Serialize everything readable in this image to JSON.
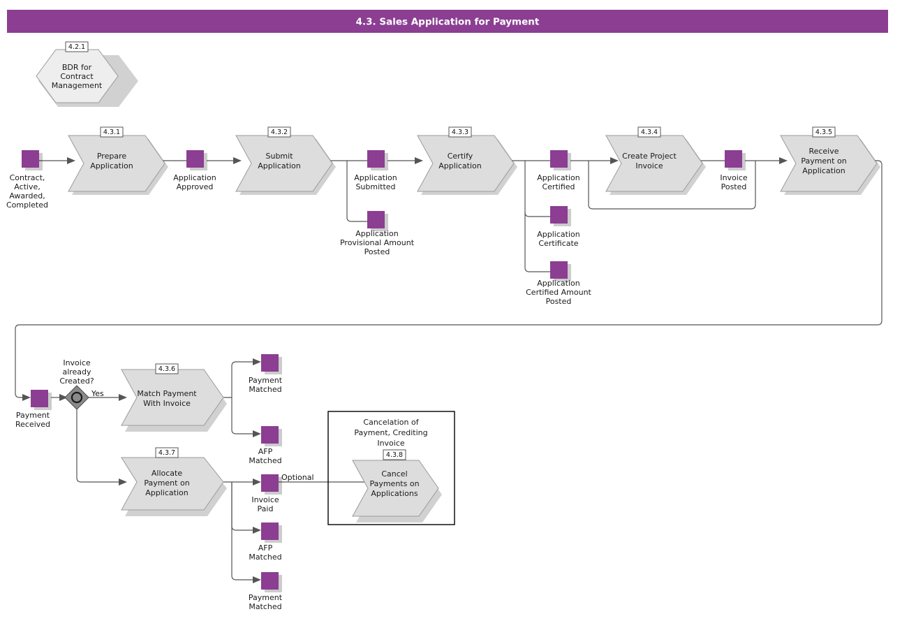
{
  "diagram": {
    "title": "4.3. Sales Application for Payment",
    "accent_color": "#8B3E92",
    "shape_fill": "#DDDDDD",
    "shape_stroke": "#9A9A9A",
    "hex_fill": "#EEEEEE",
    "line_color": "#555555"
  },
  "link_node": {
    "code": "4.2.1",
    "label_lines": [
      "BDR for",
      "Contract",
      "Management"
    ]
  },
  "tasks": [
    {
      "code": "4.3.1",
      "label_lines": [
        "Prepare",
        "Application"
      ]
    },
    {
      "code": "4.3.2",
      "label_lines": [
        "Submit",
        "Application"
      ]
    },
    {
      "code": "4.3.3",
      "label_lines": [
        "Certify",
        "Application"
      ]
    },
    {
      "code": "4.3.4",
      "label_lines": [
        "Create Project",
        "Invoice"
      ]
    },
    {
      "code": "4.3.5",
      "label_lines": [
        "Receive",
        "Payment on",
        "Application"
      ]
    },
    {
      "code": "4.3.6",
      "label_lines": [
        "Match Payment",
        "With Invoice"
      ]
    },
    {
      "code": "4.3.7",
      "label_lines": [
        "Allocate",
        "Payment on",
        "Application"
      ]
    },
    {
      "code": "4.3.8",
      "label_lines": [
        "Cancel",
        "Payments on",
        "Applications"
      ]
    }
  ],
  "events": [
    {
      "id": "contract-active",
      "label_lines": [
        "Contract,",
        "Active,",
        "Awarded,",
        "Completed"
      ]
    },
    {
      "id": "application-approved",
      "label_lines": [
        "Application",
        "Approved"
      ]
    },
    {
      "id": "application-submitted",
      "label_lines": [
        "Application",
        "Submitted"
      ]
    },
    {
      "id": "application-provisional-amount-posted",
      "label_lines": [
        "Application",
        "Provisional Amount",
        "Posted"
      ]
    },
    {
      "id": "application-certified",
      "label_lines": [
        "Application",
        "Certified"
      ]
    },
    {
      "id": "application-certificate",
      "label_lines": [
        "Application",
        "Certificate"
      ]
    },
    {
      "id": "application-certified-amount-posted",
      "label_lines": [
        "Application",
        "Certified Amount",
        "Posted"
      ]
    },
    {
      "id": "invoice-posted",
      "label_lines": [
        "Invoice",
        "Posted"
      ]
    },
    {
      "id": "payment-received",
      "label_lines": [
        "Payment",
        "Received"
      ]
    },
    {
      "id": "payment-matched-top",
      "label_lines": [
        "Payment",
        "Matched"
      ]
    },
    {
      "id": "afp-matched-top",
      "label_lines": [
        "AFP",
        "Matched"
      ]
    },
    {
      "id": "invoice-paid",
      "label_lines": [
        "Invoice",
        "Paid"
      ]
    },
    {
      "id": "afp-matched-bottom",
      "label_lines": [
        "AFP",
        "Matched"
      ]
    },
    {
      "id": "payment-matched-bottom",
      "label_lines": [
        "Payment",
        "Matched"
      ]
    }
  ],
  "gateway": {
    "question_lines": [
      "Invoice",
      "already",
      "Created?"
    ],
    "yes_label": "Yes"
  },
  "edge_labels": {
    "optional": "Optional"
  },
  "group": {
    "title_lines": [
      "Cancelation of",
      "Payment, Crediting",
      "Invoice"
    ]
  }
}
